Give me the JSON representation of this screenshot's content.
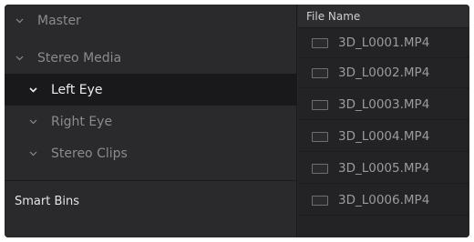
{
  "bins": {
    "items": [
      {
        "label": "Master",
        "level": 0,
        "selected": false
      },
      {
        "label": "Stereo Media",
        "level": 0,
        "selected": false
      },
      {
        "label": "Left Eye",
        "level": 1,
        "selected": true
      },
      {
        "label": "Right Eye",
        "level": 1,
        "selected": false
      },
      {
        "label": "Stereo Clips",
        "level": 1,
        "selected": false
      }
    ],
    "smart_bins_label": "Smart Bins",
    "chevron_icon": "chevron-down-icon"
  },
  "files": {
    "column_header": "File Name",
    "rows": [
      {
        "name": "3D_L0001.MP4"
      },
      {
        "name": "3D_L0002.MP4"
      },
      {
        "name": "3D_L0003.MP4"
      },
      {
        "name": "3D_L0004.MP4"
      },
      {
        "name": "3D_L0005.MP4"
      },
      {
        "name": "3D_L0006.MP4"
      }
    ],
    "row_icon": "clip-icon"
  },
  "colors": {
    "panel_bg": "#2a2a2d",
    "selected_bg": "#19191b",
    "text_dim": "#8b8b8e",
    "text_bright": "#ececec"
  }
}
